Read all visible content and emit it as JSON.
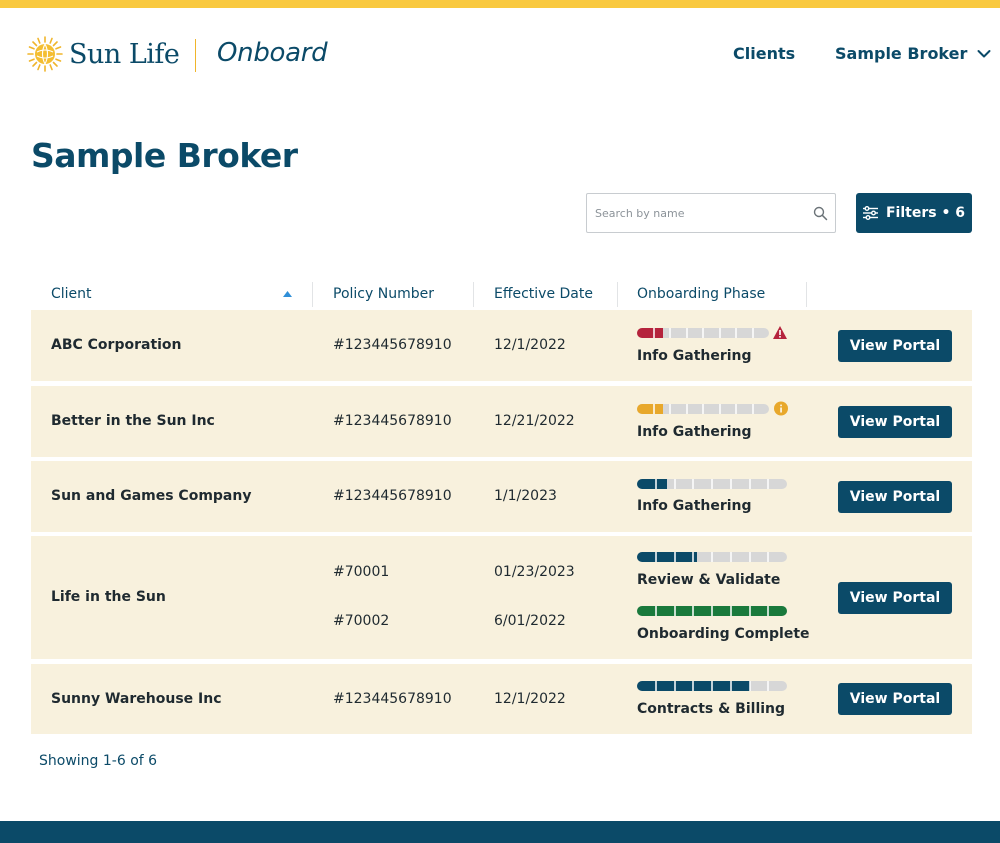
{
  "colors": {
    "brand_blue": "#0b4a68",
    "brand_yellow": "#f9c940",
    "row_bg": "#f8f1dd",
    "status_red": "#b5233c",
    "status_amber": "#e8a82b",
    "status_green": "#1a7a3c",
    "bar_empty": "#d7d7d7"
  },
  "header": {
    "brand": "Sun Life",
    "product": "Onboard",
    "nav": {
      "clients": "Clients",
      "account": "Sample Broker"
    }
  },
  "page": {
    "title": "Sample Broker"
  },
  "search": {
    "placeholder": "Search by name",
    "value": ""
  },
  "filters": {
    "label": "Filters • 6"
  },
  "table": {
    "columns": {
      "client": "Client",
      "policy": "Policy Number",
      "date": "Effective Date",
      "phase": "Onboarding Phase"
    },
    "sort": {
      "column": "Client",
      "direction": "ascending"
    },
    "rows": [
      {
        "client": "ABC Corporation",
        "button": "View Portal",
        "policies": [
          {
            "number": "#123445678910",
            "date": "12/1/2022",
            "phase": "Info Gathering",
            "progress": 0.2,
            "bar_color": "#b5233c",
            "status_icon": "warning-icon"
          }
        ]
      },
      {
        "client": "Better in the Sun Inc",
        "button": "View Portal",
        "policies": [
          {
            "number": "#123445678910",
            "date": "12/21/2022",
            "phase": "Info Gathering",
            "progress": 0.2,
            "bar_color": "#e8a82b",
            "status_icon": "info-icon"
          }
        ]
      },
      {
        "client": "Sun and Games Company",
        "button": "View Portal",
        "policies": [
          {
            "number": "#123445678910",
            "date": "1/1/2023",
            "phase": "Info Gathering",
            "progress": 0.2,
            "bar_color": "#0b4a68",
            "status_icon": ""
          }
        ]
      },
      {
        "client": "Life in the Sun",
        "button": "View Portal",
        "policies": [
          {
            "number": "#70001",
            "date": "01/23/2023",
            "phase": "Review & Validate",
            "progress": 0.4,
            "bar_color": "#0b4a68",
            "status_icon": ""
          },
          {
            "number": "#70002",
            "date": "6/01/2022",
            "phase": "Onboarding Complete",
            "progress": 1.0,
            "bar_color": "#1a7a3c",
            "status_icon": ""
          }
        ]
      },
      {
        "client": "Sunny Warehouse Inc",
        "button": "View Portal",
        "policies": [
          {
            "number": "#123445678910",
            "date": "12/1/2022",
            "phase": "Contracts & Billing",
            "progress": 0.75,
            "bar_color": "#0b4a68",
            "status_icon": ""
          }
        ]
      }
    ]
  },
  "footer": {
    "showing": "Showing 1-6 of 6"
  }
}
